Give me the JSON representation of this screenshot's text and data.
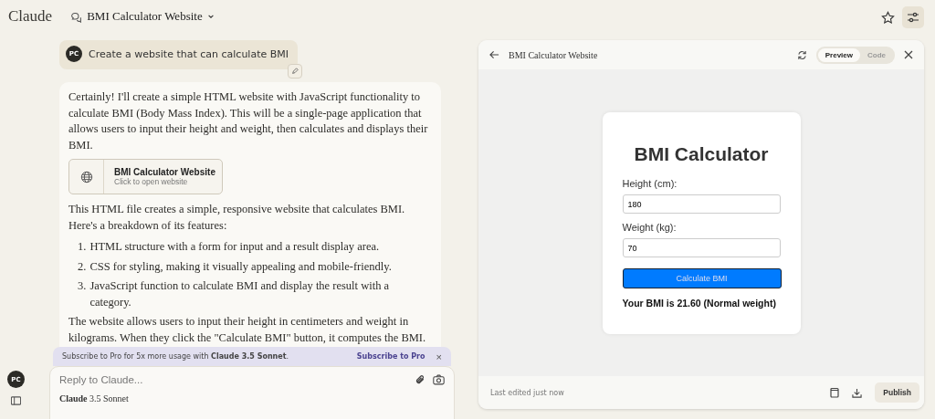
{
  "app": {
    "logo": "Claude",
    "conversation_title": "BMI Calculator Website"
  },
  "user_message": {
    "avatar": "PC",
    "text": "Create a website that can calculate BMI"
  },
  "assistant_message": {
    "intro": "Certainly! I'll create a simple HTML website with JavaScript functionality to calculate BMI (Body Mass Index). This will be a single-page application that allows users to input their height and weight, then calculates and displays their BMI.",
    "artifact": {
      "title": "BMI Calculator Website",
      "subtitle": "Click to open website"
    },
    "summary": "This HTML file creates a simple, responsive website that calculates BMI. Here's a breakdown of its features:",
    "features": [
      {
        "number": "1.",
        "text": "HTML structure with a form for input and a result display area."
      },
      {
        "number": "2.",
        "text": "CSS for styling, making it visually appealing and mobile-friendly."
      },
      {
        "number": "3.",
        "text": "JavaScript function to calculate BMI and display the result with a category."
      }
    ],
    "closing": "The website allows users to input their height in centimeters and weight in kilograms. When they click the \"Calculate BMI\" button, it computes the BMI."
  },
  "banner": {
    "text": "Subscribe to Pro for 5x more usage with **Claude 3.5 Sonnet**.",
    "action": "Subscribe to Pro",
    "close": "×"
  },
  "composer": {
    "placeholder": "Reply to Claude...",
    "model_brand": "Claude",
    "model_version": "3.5 Sonnet"
  },
  "sidebar": {
    "avatar": "PC"
  },
  "preview_panel": {
    "title": "BMI Calculator Website",
    "tabs": [
      {
        "label": "Preview",
        "selected": true
      },
      {
        "label": "Code",
        "selected": false
      }
    ],
    "status": "Last edited just now",
    "publish": "Publish",
    "page": {
      "heading": "BMI Calculator",
      "fields": [
        {
          "label": "Height (cm):",
          "value": "180"
        },
        {
          "label": "Weight (kg):",
          "value": "70"
        }
      ],
      "button": "Calculate BMI",
      "result": "Your BMI is 21.60 (Normal weight)"
    }
  }
}
